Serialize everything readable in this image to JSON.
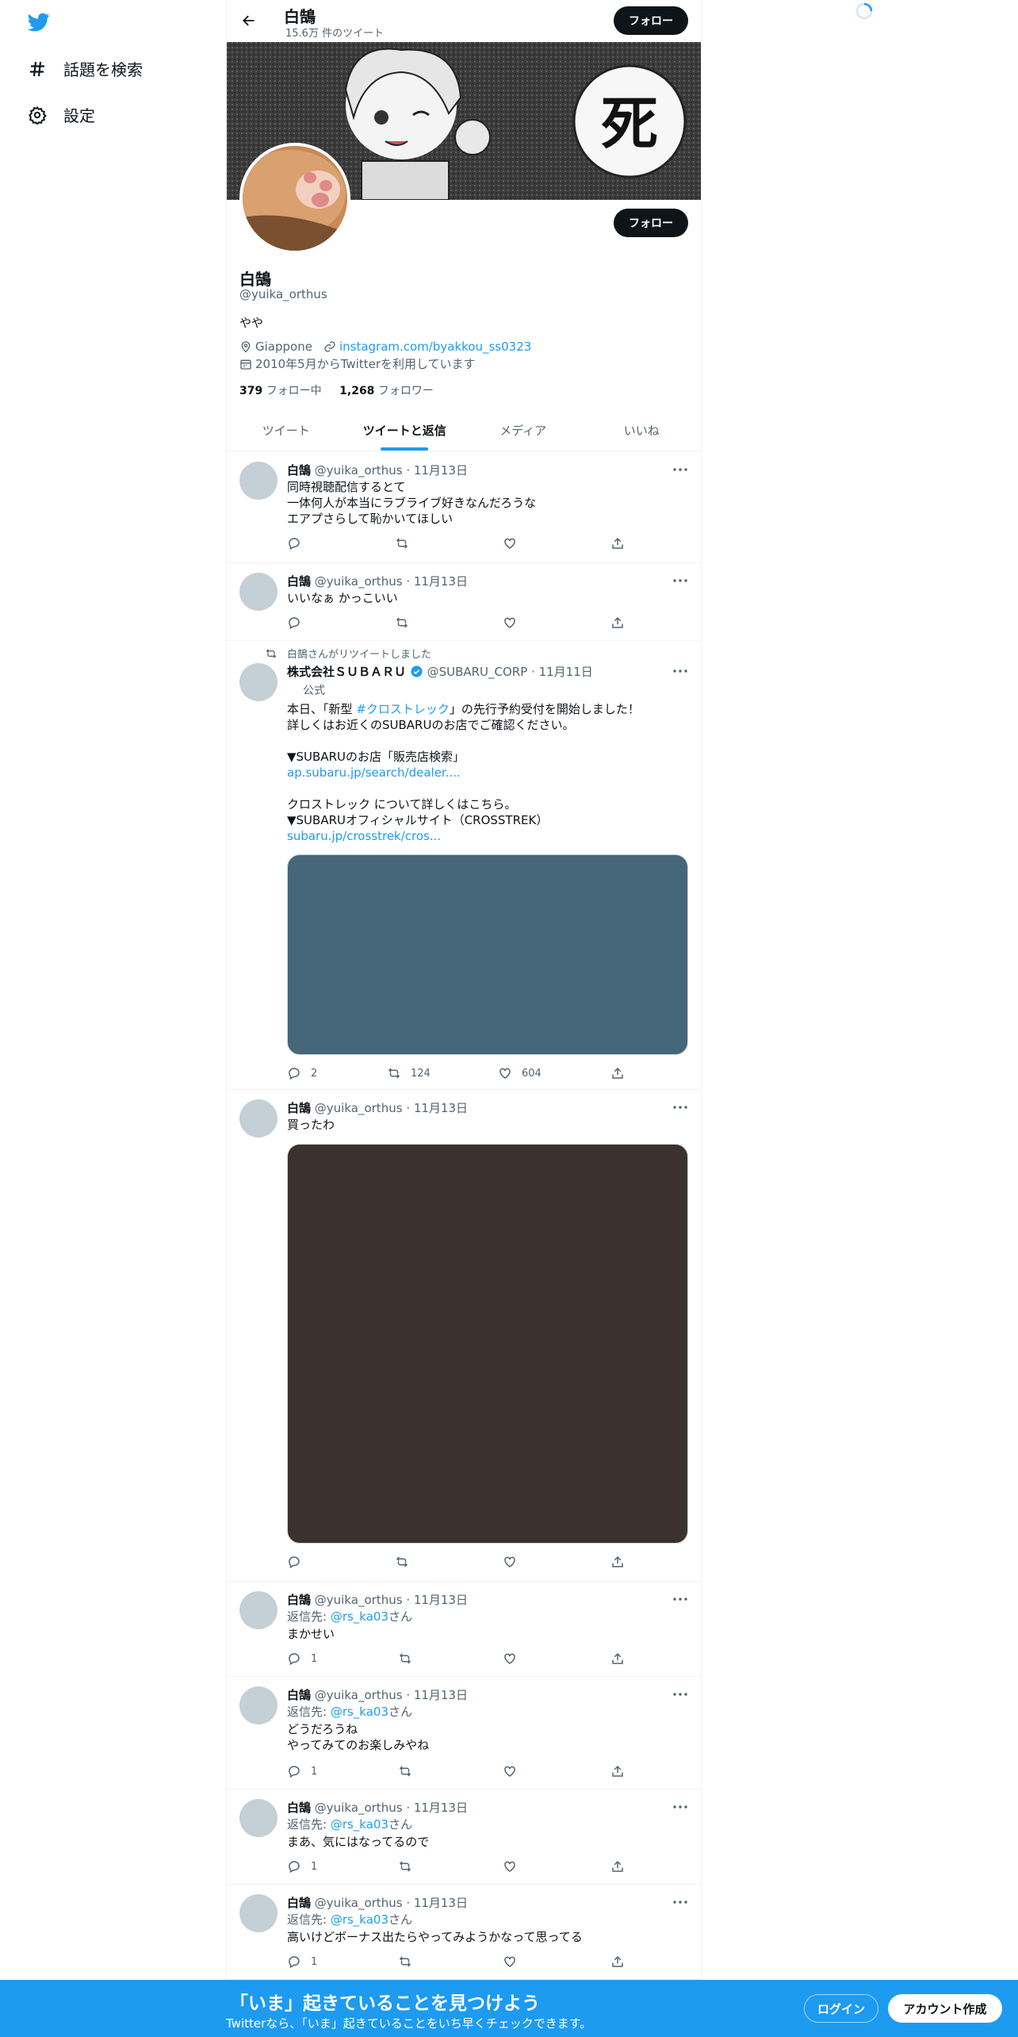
{
  "nav": {
    "explore_label": "話題を検索",
    "settings_label": "設定"
  },
  "header": {
    "name": "白鵠",
    "tweet_count": "15.6万 件のツイート",
    "follow_label": "フォロー"
  },
  "profile": {
    "name": "白鵠",
    "handle": "@yuika_orthus",
    "bio": "やや",
    "location": "Giappone",
    "website": "instagram.com/byakkou_ss0323",
    "joined": "2010年5月からTwitterを利用しています",
    "following_count": "379",
    "following_label": "フォロー中",
    "followers_count": "1,268",
    "followers_label": "フォロワー",
    "follow_label": "フォロー",
    "banner_glyph": "死"
  },
  "tabs": [
    "ツイート",
    "ツイートと返信",
    "メディア",
    "いいね"
  ],
  "tweets": [
    {
      "name": "白鵠",
      "handle": "@yuika_orthus",
      "date": "· 11月13日",
      "text": "同時視聴配信するとて\n一体何人が本当にラブライブ好きなんだろうな\nエアプさらして恥かいてほしい"
    },
    {
      "name": "白鵠",
      "handle": "@yuika_orthus",
      "date": "· 11月13日",
      "text": "いいなぁ かっこいい"
    },
    {
      "retweet_label": "白鵠さんがリツイートしました",
      "name": "株式会社ＳＵＢＡＲＵ",
      "handle": "@SUBARU_CORP",
      "date": "· 11月11日",
      "official": "公式",
      "line1_pre": "本日、「新型 ",
      "line1_tag": "#クロストレック",
      "line1_post": "」の先行予約受付を開始しました！",
      "line2": "詳しくはお近くのSUBARUのお店でご確認ください。",
      "line3": "▼SUBARUのお店「販売店検索」",
      "link1": "ap.subaru.jp/search/dealer....",
      "line4": "クロストレック について詳しくはこちら。",
      "line5": "▼SUBARUオフィシャルサイト（CROSSTREK）",
      "link2": "subaru.jp/crosstrek/cros...",
      "media_color": "#46667a",
      "replies": "2",
      "retweets": "124",
      "likes": "604"
    },
    {
      "name": "白鵠",
      "handle": "@yuika_orthus",
      "date": "· 11月13日",
      "text": "買ったわ",
      "media_color": "#3b312d"
    },
    {
      "name": "白鵠",
      "handle": "@yuika_orthus",
      "date": "· 11月13日",
      "reply_prefix": "返信先: ",
      "reply_to": "@rs_ka03",
      "reply_suffix": "さん",
      "text": "まかせい",
      "replies": "1"
    },
    {
      "name": "白鵠",
      "handle": "@yuika_orthus",
      "date": "· 11月13日",
      "reply_prefix": "返信先: ",
      "reply_to": "@rs_ka03",
      "reply_suffix": "さん",
      "text": "どうだろうね\nやってみてのお楽しみやね",
      "replies": "1"
    },
    {
      "name": "白鵠",
      "handle": "@yuika_orthus",
      "date": "· 11月13日",
      "reply_prefix": "返信先: ",
      "reply_to": "@rs_ka03",
      "reply_suffix": "さん",
      "text": "まあ、気にはなってるので",
      "replies": "1"
    },
    {
      "name": "白鵠",
      "handle": "@yuika_orthus",
      "date": "· 11月13日",
      "reply_prefix": "返信先: ",
      "reply_to": "@rs_ka03",
      "reply_suffix": "さん",
      "text": "高いけどボーナス出たらやってみようかなって思ってる",
      "replies": "1"
    }
  ],
  "bottom_bar": {
    "title": "「いま」起きていることを見つけよう",
    "subtitle": "Twitterなら、「いま」起きていることをいち早くチェックできます。",
    "login_label": "ログイン",
    "signup_label": "アカウント作成"
  },
  "colors": {
    "accent": "#1d9bf0",
    "text": "#0f1419",
    "muted": "#536471"
  }
}
